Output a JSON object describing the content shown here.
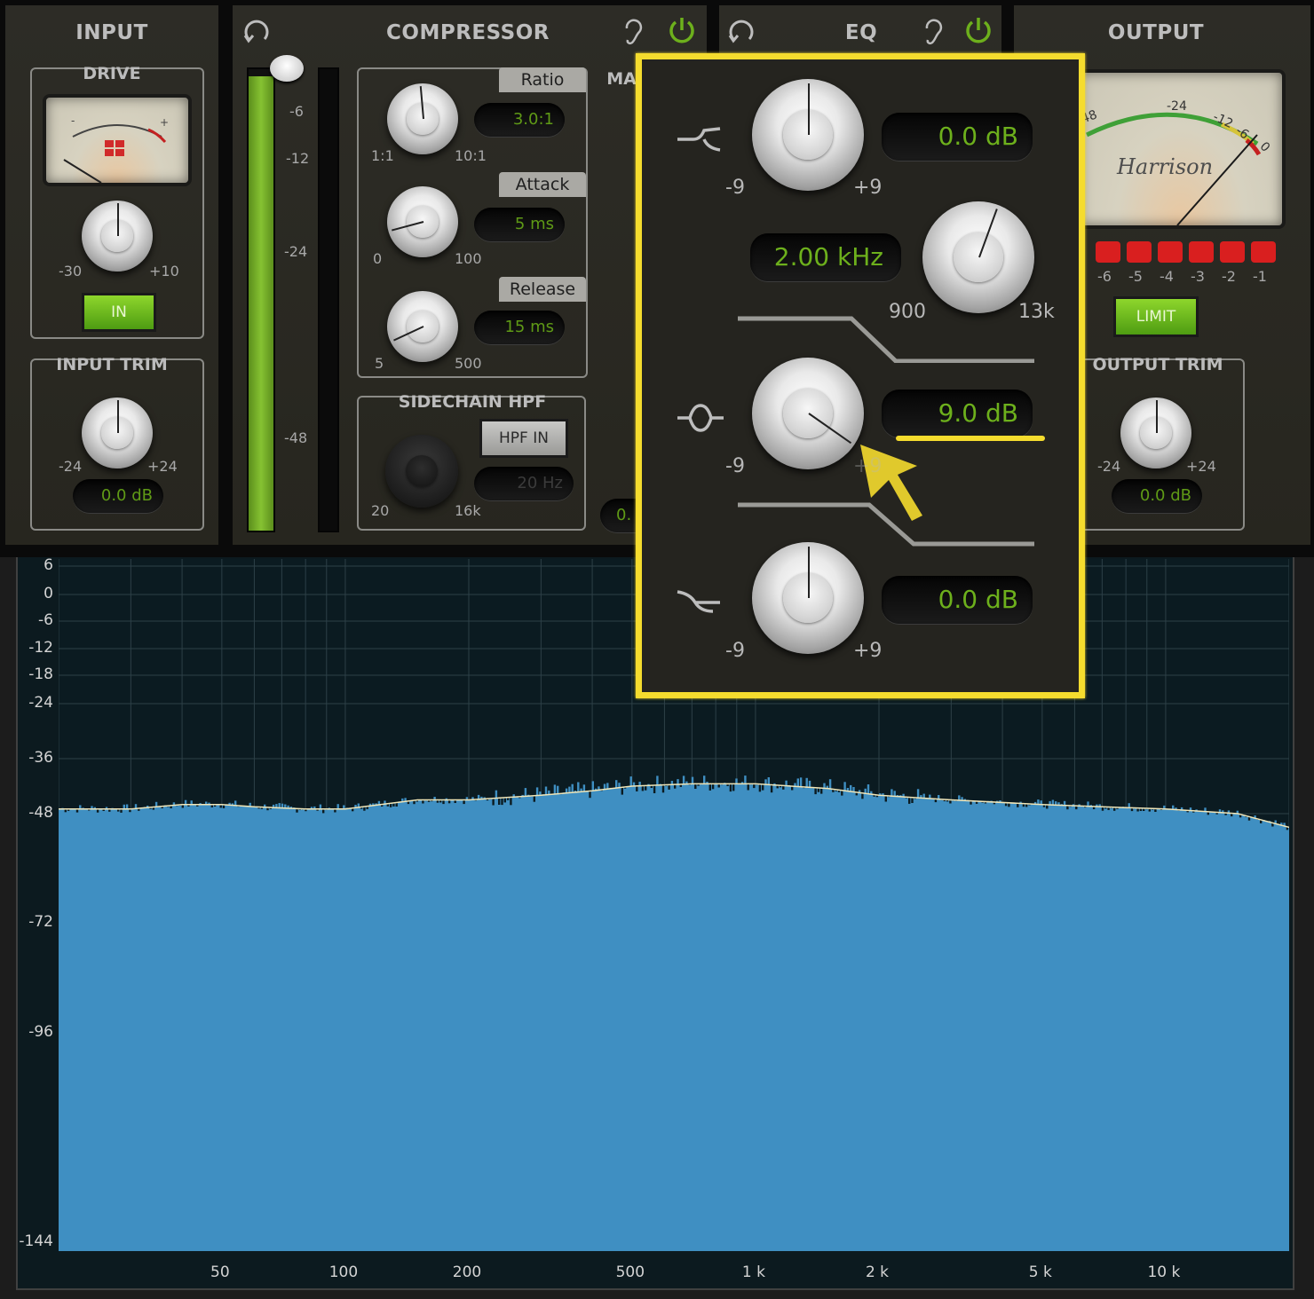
{
  "input": {
    "title": "INPUT",
    "drive_label": "DRIVE",
    "drive_min": "-30",
    "drive_max": "+10",
    "in_button": "IN",
    "trim_label": "INPUT TRIM",
    "trim_min": "-24",
    "trim_max": "+24",
    "trim_value": "0.0 dB"
  },
  "compressor": {
    "title": "COMPRESSOR",
    "meter_ticks": [
      "-6",
      "-12",
      "-24",
      "-48"
    ],
    "ratio": {
      "label": "Ratio",
      "value": "3.0:1",
      "min": "1:1",
      "max": "10:1"
    },
    "attack": {
      "label": "Attack",
      "value": "5 ms",
      "min": "0",
      "max": "100"
    },
    "release": {
      "label": "Release",
      "value": "15 ms",
      "min": "5",
      "max": "500"
    },
    "makeup_label_partial": "MA",
    "makeup_value_partial": "0.",
    "sidechain_label": "SIDECHAIN HPF",
    "hpf_button": "HPF IN",
    "hpf_value": "20 Hz",
    "hpf_min": "20",
    "hpf_max": "16k"
  },
  "eq": {
    "title": "EQ",
    "low": {
      "value": "0.0 dB",
      "min": "-9",
      "max": "+9"
    },
    "mid_freq": {
      "value": "2.00 kHz",
      "min": "900",
      "max": "13k"
    },
    "mid": {
      "value": "9.0 dB",
      "min": "-9",
      "max": "+9"
    },
    "high": {
      "value": "0.0 dB",
      "min": "-9",
      "max": "+9"
    }
  },
  "output": {
    "title": "OUTPUT",
    "meter_scale": [
      "48",
      "-24",
      "-12",
      "-6",
      "0"
    ],
    "brand": "Harrison",
    "limit_leds": [
      "-6",
      "-5",
      "-4",
      "-3",
      "-2",
      "-1"
    ],
    "limit_button": "LIMIT",
    "trim_label": "OUTPUT TRIM",
    "trim_min": "-24",
    "trim_max": "+24",
    "trim_value": "0.0 dB"
  },
  "colors": {
    "accent_green": "#6db01c",
    "highlight_yellow": "#f5dc2e",
    "spectrum_blue": "#3f8fc2",
    "led_red": "#d91f1f"
  },
  "chart_data": {
    "type": "area",
    "title": "",
    "xlabel": "",
    "ylabel": "",
    "x_scale": "log",
    "xlim": [
      20,
      20000
    ],
    "ylim": [
      -144,
      6
    ],
    "y_ticks": [
      6,
      0,
      -6,
      -12,
      -18,
      -24,
      -36,
      -48,
      -72,
      -96,
      -144
    ],
    "x_ticks": [
      {
        "value": 50,
        "label": "50"
      },
      {
        "value": 100,
        "label": "100"
      },
      {
        "value": 200,
        "label": "200"
      },
      {
        "value": 500,
        "label": "500"
      },
      {
        "value": 1000,
        "label": "1 k"
      },
      {
        "value": 2000,
        "label": "2 k"
      },
      {
        "value": 5000,
        "label": "5 k"
      },
      {
        "value": 10000,
        "label": "10 k"
      }
    ],
    "grid": true,
    "series": [
      {
        "x": [
          20,
          30,
          40,
          50,
          60,
          80,
          100,
          150,
          200,
          300,
          400,
          500,
          700,
          1000,
          1500,
          2000,
          3000,
          5000,
          7000,
          10000,
          15000,
          20000
        ],
        "y": [
          -47,
          -47,
          -46,
          -46,
          -46.5,
          -47,
          -47,
          -45,
          -45,
          -44,
          -43,
          -42,
          -41.5,
          -41.5,
          -42.5,
          -44,
          -45,
          -46,
          -46.5,
          -47,
          -48,
          -51
        ]
      }
    ]
  }
}
